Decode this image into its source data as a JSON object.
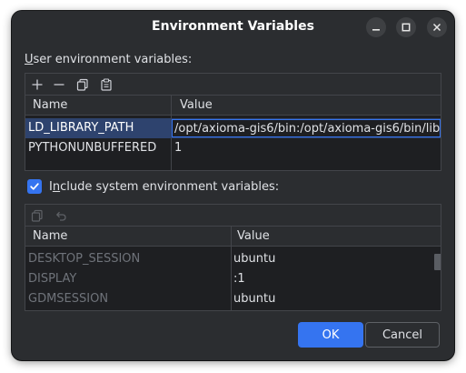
{
  "window": {
    "title": "Environment Variables"
  },
  "user_vars": {
    "label_u": "U",
    "label_rest": "ser environment variables:",
    "toolbar_icons": [
      "plus-icon",
      "minus-icon",
      "copy-icon",
      "paste-icon"
    ],
    "columns": [
      "Name",
      "Value"
    ],
    "rows": [
      {
        "name": "LD_LIBRARY_PATH",
        "value": "/opt/axioma-gis6/bin:/opt/axioma-gis6/bin/lib",
        "selected": true
      },
      {
        "name": "PYTHONUNBUFFERED",
        "value": "1",
        "selected": false
      }
    ]
  },
  "system_vars": {
    "checkbox_checked": true,
    "label_pre": "I",
    "label_u": "n",
    "label_rest": "clude system environment variables:",
    "toolbar_icons": [
      "copy-icon",
      "undo-icon"
    ],
    "columns": [
      "Name",
      "Value"
    ],
    "rows": [
      {
        "name": "DESKTOP_SESSION",
        "value": "ubuntu"
      },
      {
        "name": "DISPLAY",
        "value": ":1"
      },
      {
        "name": "GDMSESSION",
        "value": "ubuntu"
      }
    ]
  },
  "buttons": {
    "ok": "OK",
    "cancel": "Cancel"
  },
  "colors": {
    "accent": "#3574f0",
    "background": "#2b2d30",
    "selection": "#2e436e"
  }
}
